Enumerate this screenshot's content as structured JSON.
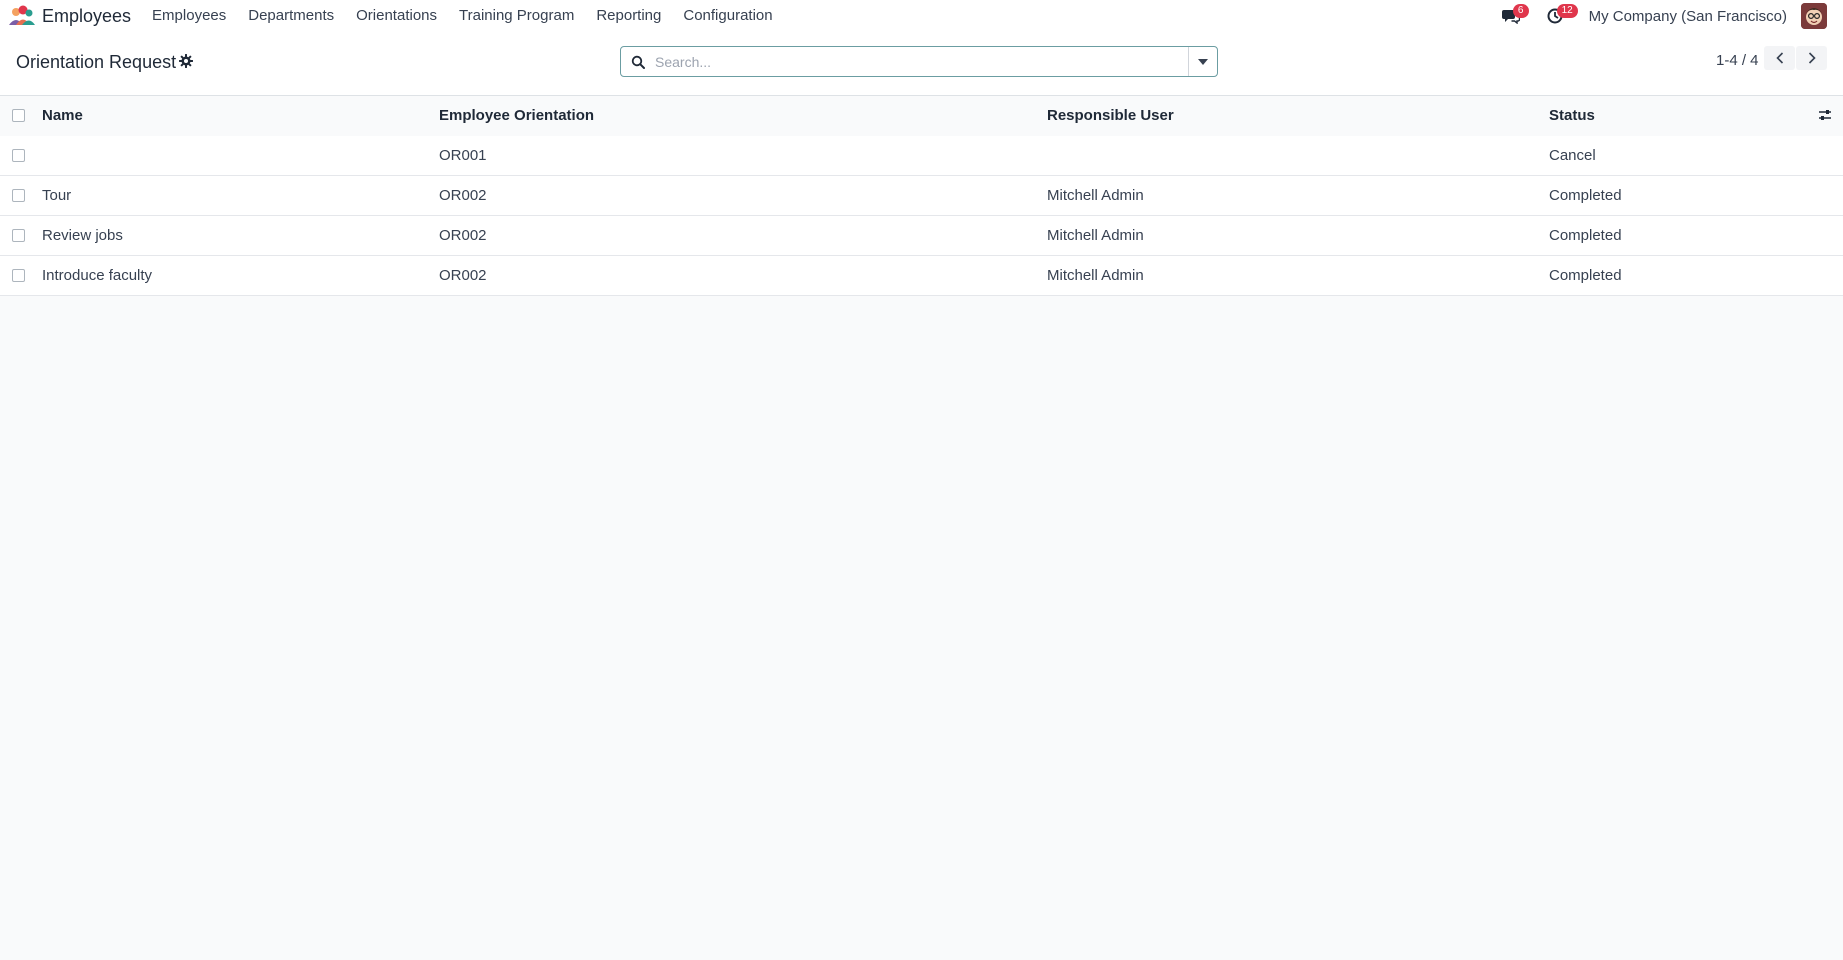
{
  "navbar": {
    "app_name": "Employees",
    "menu": [
      "Employees",
      "Departments",
      "Orientations",
      "Training Program",
      "Reporting",
      "Configuration"
    ],
    "messages_badge": "6",
    "activities_badge": "12",
    "company": "My Company (San Francisco)"
  },
  "control": {
    "title": "Orientation Request",
    "search_placeholder": "Search...",
    "pager": "1-4 / 4"
  },
  "table": {
    "headers": [
      "Name",
      "Employee Orientation",
      "Responsible User",
      "Status"
    ],
    "rows": [
      {
        "name": "",
        "orientation": "OR001",
        "user": "",
        "status": "Cancel"
      },
      {
        "name": "Tour",
        "orientation": "OR002",
        "user": "Mitchell Admin",
        "status": "Completed"
      },
      {
        "name": "Review jobs",
        "orientation": "OR002",
        "user": "Mitchell Admin",
        "status": "Completed"
      },
      {
        "name": "Introduce faculty",
        "orientation": "OR002",
        "user": "Mitchell Admin",
        "status": "Completed"
      }
    ]
  },
  "colors": {
    "accent": "#6b9da2",
    "badge": "#e0364c"
  }
}
